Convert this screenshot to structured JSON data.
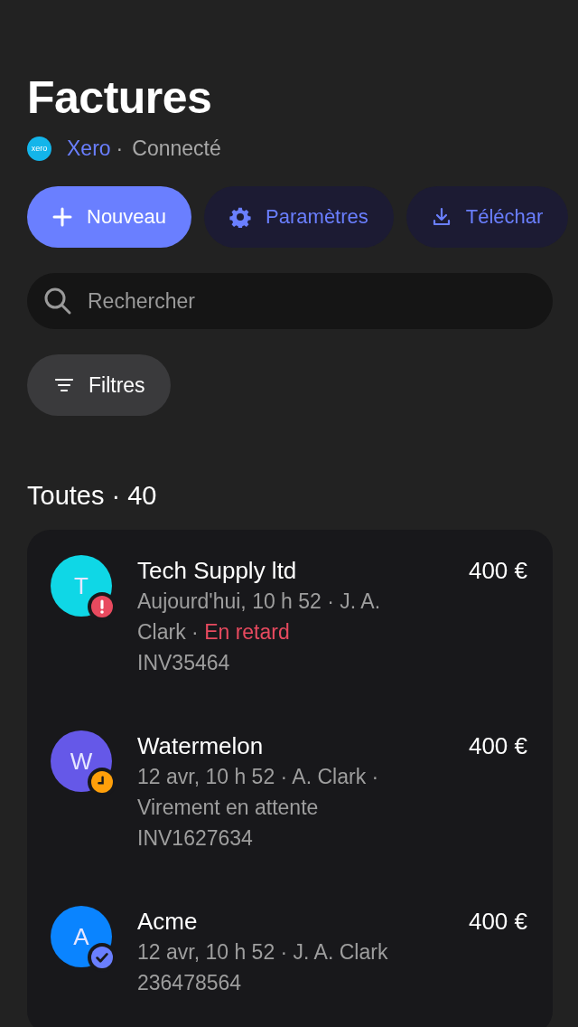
{
  "title": "Factures",
  "connection": {
    "logo_text": "xero",
    "service": "Xero",
    "separator": "·",
    "status": "Connecté"
  },
  "actions": [
    {
      "label": "Nouveau",
      "kind": "new"
    },
    {
      "label": "Paramètres",
      "kind": "settings"
    },
    {
      "label": "Téléchar",
      "kind": "download"
    }
  ],
  "search": {
    "placeholder": "Rechercher"
  },
  "filter": {
    "label": "Filtres"
  },
  "section": {
    "heading": "Toutes · 40"
  },
  "invoices": [
    {
      "initial": "T",
      "color": "#0fd7e6",
      "name": "Tech Supply ltd",
      "amount": "400 €",
      "meta": "Aujourd'hui, 10 h 52 · J. A. Clark · ",
      "status": {
        "text": "En retard"
      },
      "kind": "overdue",
      "reference": "INV35464"
    },
    {
      "initial": "W",
      "color": "#6558e8",
      "name": "Watermelon",
      "amount": "400 €",
      "meta": "12 avr, 10 h 52 · A. Clark · ",
      "status": {
        "text": "Virement en attente"
      },
      "kind": "pending",
      "reference": "INV1627634"
    },
    {
      "initial": "A",
      "color": "#0a84ff",
      "name": "Acme",
      "amount": "400 €",
      "meta": "12 avr, 10 h 52 · J. A. Clark",
      "kind": "paid",
      "reference": "236478564"
    }
  ]
}
